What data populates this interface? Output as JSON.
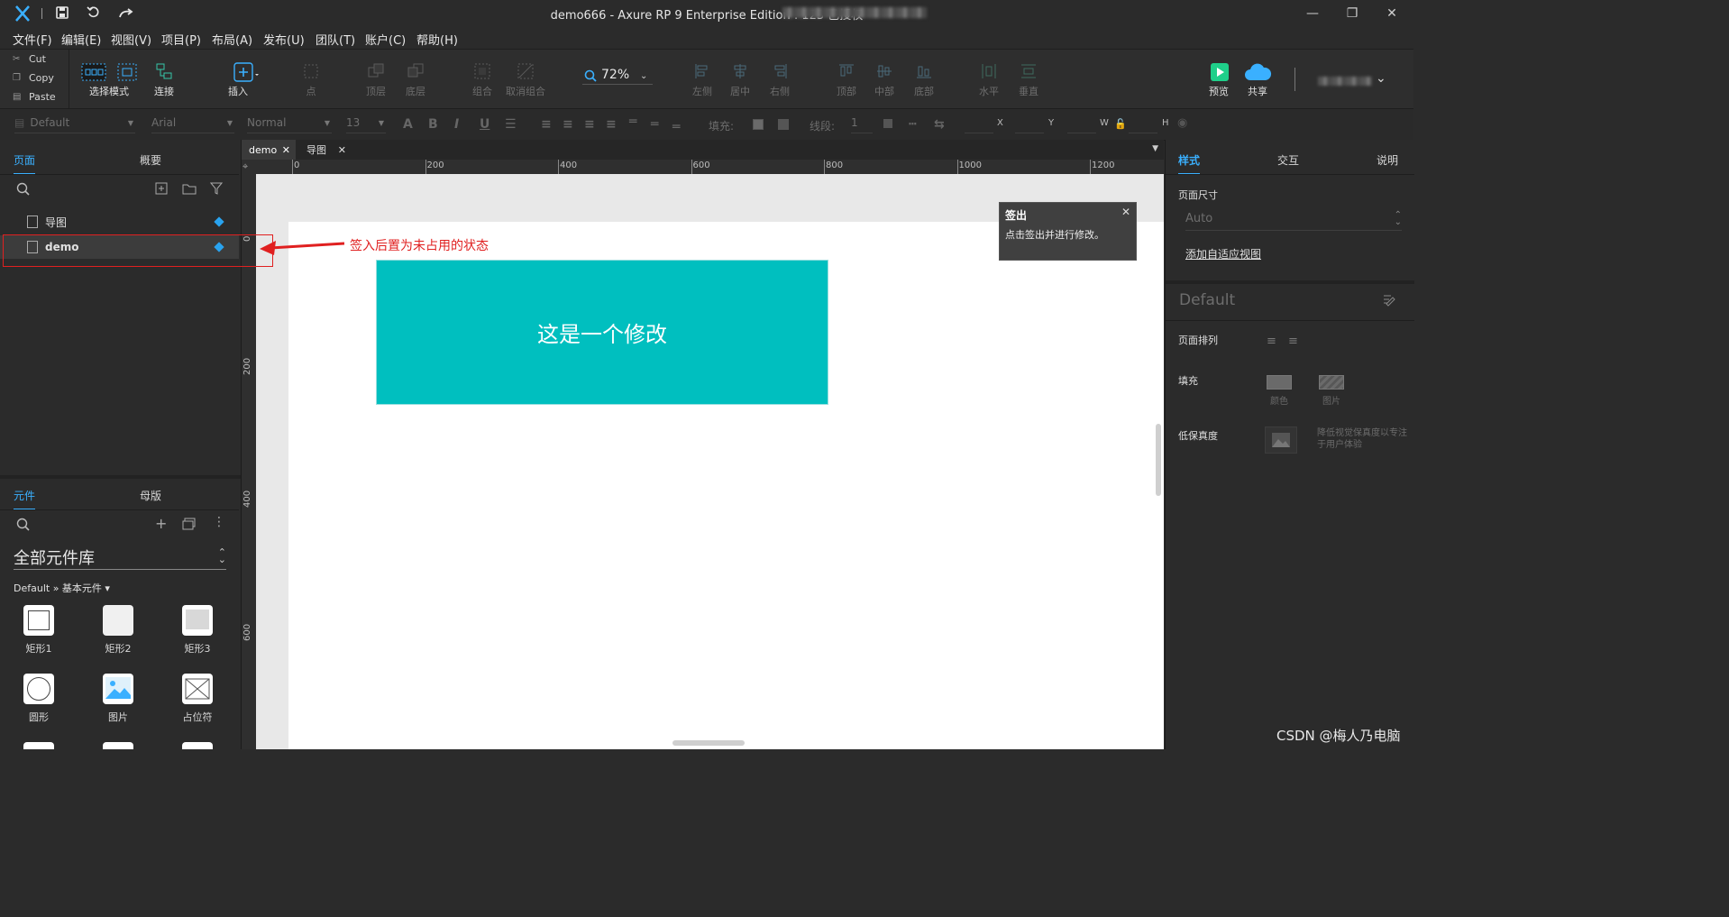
{
  "window": {
    "title": "demo666 - Axure RP 9 Enterprise Edition : 123 已授权",
    "controls": {
      "minimize": "—",
      "restore": "❐",
      "close": "✕"
    }
  },
  "menu": [
    "文件(F)",
    "编辑(E)",
    "视图(V)",
    "项目(P)",
    "布局(A)",
    "发布(U)",
    "团队(T)",
    "账户(C)",
    "帮助(H)"
  ],
  "clipboard": {
    "cut": "Cut",
    "copy": "Copy",
    "paste": "Paste"
  },
  "toolbar": {
    "select_mode": "选择模式",
    "connect": "连接",
    "insert": "插入",
    "point": "点",
    "top_layer": "顶层",
    "bottom_layer": "底层",
    "group": "组合",
    "ungroup": "取消组合",
    "zoom": "72%",
    "align_left": "左侧",
    "align_center": "居中",
    "align_right": "右侧",
    "align_top": "顶部",
    "align_middle": "中部",
    "align_bottom": "底部",
    "distribute_h": "水平",
    "distribute_v": "垂直",
    "preview": "预览",
    "share": "共享"
  },
  "format": {
    "style": "Default",
    "font": "Arial",
    "weight": "Normal",
    "size": "13",
    "fill_label": "填充:",
    "line_label": "线段:",
    "line_value": "1",
    "x": "X",
    "y": "Y",
    "w": "W",
    "h": "H"
  },
  "pages_panel": {
    "tab_pages": "页面",
    "tab_outline": "概要",
    "items": [
      {
        "label": "导图"
      },
      {
        "label": "demo"
      }
    ]
  },
  "annotation": {
    "text": "签入后置为未占用的状态",
    "color": "#e02020"
  },
  "widgets_panel": {
    "tab_widgets": "元件",
    "tab_masters": "母版",
    "library": "全部元件库",
    "breadcrumb": "Default » 基本元件 ▾",
    "items": [
      {
        "label": "矩形1"
      },
      {
        "label": "矩形2"
      },
      {
        "label": "矩形3"
      },
      {
        "label": "圆形"
      },
      {
        "label": "图片"
      },
      {
        "label": "占位符"
      }
    ]
  },
  "doc_tabs": [
    {
      "label": "demo"
    },
    {
      "label": "导图"
    }
  ],
  "ruler": {
    "h": [
      "0",
      "200",
      "400",
      "600",
      "800",
      "1000",
      "1200"
    ],
    "v": [
      "0",
      "200",
      "400",
      "600"
    ]
  },
  "canvas": {
    "rect_text": "这是一个修改",
    "rect_color": "#00bfbf"
  },
  "tooltip": {
    "title": "签出",
    "body": "点击签出并进行修改。",
    "close": "✕"
  },
  "style_panel": {
    "tab_style": "样式",
    "tab_interact": "交互",
    "tab_notes": "说明",
    "page_size_label": "页面尺寸",
    "page_size_value": "Auto",
    "adaptive_link": "添加自适应视图",
    "style_name": "Default",
    "page_align_label": "页面排列",
    "fill_label": "填充",
    "fill_color": "颜色",
    "fill_image": "图片",
    "low_fidelity_label": "低保真度",
    "low_fidelity_desc": "降低视觉保真度以专注于用户体验"
  },
  "watermark": "CSDN @梅人乃电脑"
}
